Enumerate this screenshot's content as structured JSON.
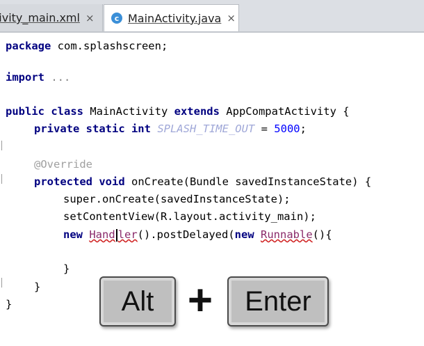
{
  "tabs": [
    {
      "label": "tivity_main.xml",
      "close": "×",
      "active": false
    },
    {
      "label": "MainActivity.java",
      "close": "×",
      "active": true,
      "icon": "java-class-icon",
      "icon_glyph": "c"
    }
  ],
  "code": {
    "line1_kw": "package",
    "line1_rest": " com.splashscreen;",
    "line2_kw": "import",
    "line2_rest": " ...",
    "line3_kw1": "public class",
    "line3_name": " MainActivity ",
    "line3_kw2": "extends",
    "line3_rest": " AppCompatActivity {",
    "line4_kw": "private static int",
    "line4_const": " SPLASH_TIME_OUT",
    "line4_eq": " = ",
    "line4_num": "5000",
    "line4_end": ";",
    "line5_ann": "@Override",
    "line6_kw": "protected void",
    "line6_rest": " onCreate(Bundle savedInstanceState) {",
    "line7": "super.onCreate(savedInstanceState);",
    "line8": "setContentView(R.layout.activity_main);",
    "line9_kw": "new",
    "line9_err_a": "Hand",
    "line9_err_b": "ler",
    "line9_mid": "().postDelayed(",
    "line9_kw2": "new",
    "line9_runnable": "Runnable",
    "line9_end": "(){",
    "line10": "}",
    "line11": "}",
    "line12": "}"
  },
  "overlay": {
    "alt_key": "Alt",
    "plus": "+",
    "enter_key": "Enter"
  }
}
